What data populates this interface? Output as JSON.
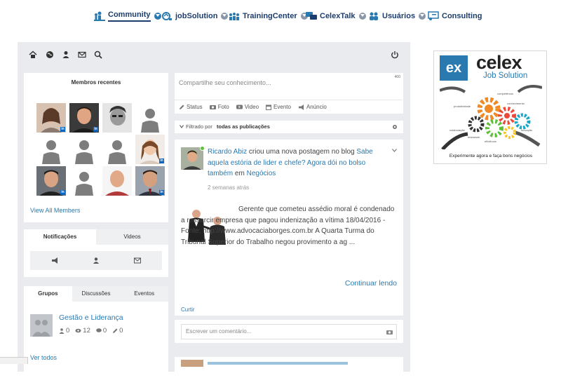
{
  "nav": {
    "items": [
      {
        "label": "Community",
        "icon": "community-icon",
        "active": true
      },
      {
        "label": "jobSolution",
        "icon": "job-solution-icon",
        "active": false
      },
      {
        "label": "TrainingCenter",
        "icon": "training-center-icon",
        "active": false
      },
      {
        "label": "CelexTalk",
        "icon": "celex-talk-icon",
        "active": false
      },
      {
        "label": "Usuários",
        "icon": "users-icon",
        "active": false
      },
      {
        "label": "Consulting",
        "icon": "consulting-icon",
        "active": false
      }
    ]
  },
  "colors": {
    "accent": "#2a7ab0",
    "nav_text": "#1d3d6e",
    "page_bg": "#e9ebee",
    "celex_blue": "#2a7ab0",
    "celex_green": "#5fbf3a"
  },
  "members": {
    "title": "Membros recentes",
    "view_all": "View All Members"
  },
  "notifications": {
    "tabs": [
      "Notificações",
      "Videos"
    ]
  },
  "groups": {
    "tabs": [
      "Grupos",
      "Discussões",
      "Eventos"
    ],
    "item": {
      "name": "Gestão e Liderança",
      "members": "0",
      "views": "12",
      "comments": "0",
      "edits": "0"
    },
    "see_all": "Ver todos"
  },
  "composer": {
    "placeholder": "Compartilhe seu conhecimento...",
    "char_count": "400",
    "actions": [
      "Status",
      "Foto",
      "Video",
      "Evento",
      "Anúncio"
    ]
  },
  "filter": {
    "prefix": "Filtrado por",
    "value": "todas as publicações"
  },
  "post": {
    "author": "Ricardo Abiz",
    "action": "criou uma nova postagem no blog",
    "link": "Sabe aquela estória de lider e chefe? Agora dói no bolso também",
    "in": "em",
    "category": "Negócios",
    "time": "2 semanas atrás",
    "excerpt": "Gerente que cometeu assédio moral é condenado a ressarcir empresa que pagou indenização a vítima 18/04/2016 - Fonte: http://www.advocaciaborges.com.br A Quarta Turma do Tribunal Superior do Trabalho negou provimento a ag ...",
    "continue": "Continuar lendo",
    "like": "Curtir",
    "comment_placeholder": "Escrever um comentário..."
  },
  "ad": {
    "brand": "celex",
    "logo_mark": "ex",
    "product": "Job Solution",
    "tagline": "Experimente agora e faça bons negócios",
    "gear_words": [
      "competência",
      "produtividade",
      "conhecimento",
      "colaboração",
      "inovação",
      "teamwork",
      "eficiência"
    ]
  }
}
